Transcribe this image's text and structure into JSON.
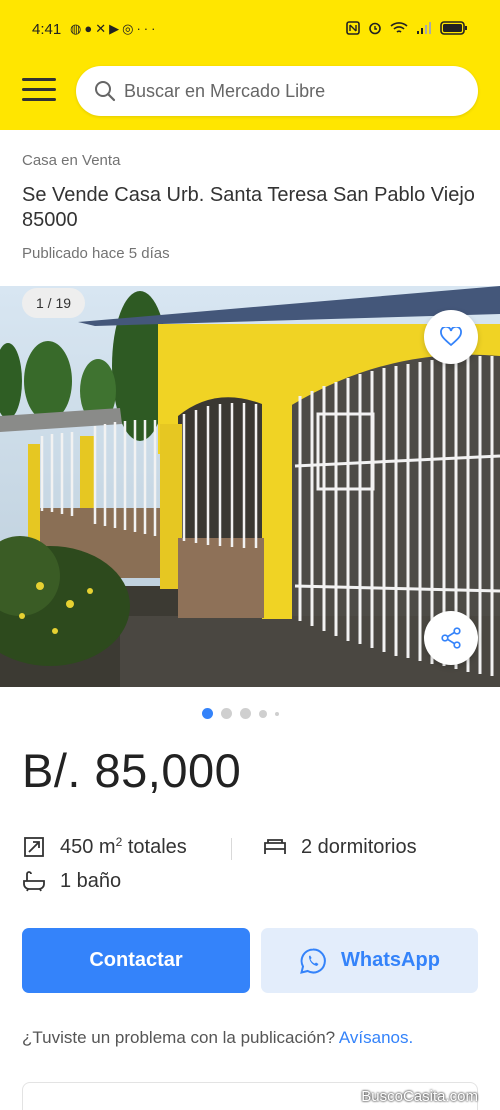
{
  "status_bar": {
    "time": "4:41",
    "more": "···"
  },
  "search": {
    "placeholder": "Buscar en Mercado Libre"
  },
  "listing": {
    "category": "Casa en Venta",
    "title": "Se Vende Casa Urb. Santa Teresa San Pablo Viejo 85000",
    "published": "Publicado hace 5 días",
    "image_counter": "1 / 19",
    "price": "B/. 85,000",
    "attributes": {
      "area_value": "450 m",
      "area_sup": "2",
      "area_suffix": " totales",
      "bedrooms": "2 dormitorios",
      "bathrooms": "1 baño"
    }
  },
  "actions": {
    "contact_label": "Contactar",
    "whatsapp_label": "WhatsApp"
  },
  "report": {
    "question": "¿Tuviste un problema con la publicación? ",
    "link": "Avísanos."
  },
  "watermark": "BuscoCasita.com",
  "colors": {
    "brand_yellow": "#ffe600",
    "accent_blue": "#3483fa",
    "whatsapp_bg": "#e3edfb"
  },
  "carousel": {
    "total_pages": 19,
    "current_page": 1
  }
}
